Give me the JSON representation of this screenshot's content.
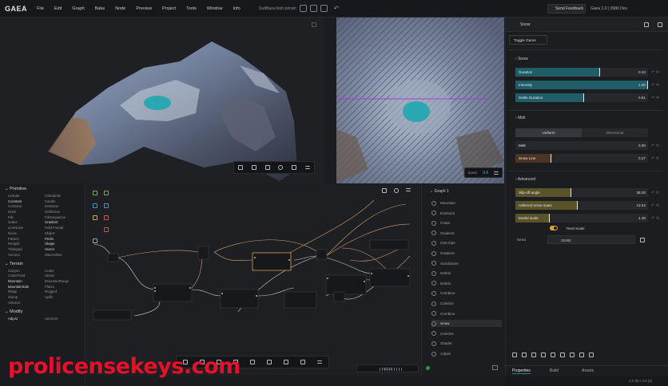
{
  "app": {
    "logo": "GAEA",
    "menu": [
      "File",
      "Edit",
      "Graph",
      "Bake",
      "Node",
      "Preview",
      "Project",
      "Tools",
      "Window",
      "Info"
    ],
    "doc_name": "SwitBassJooh.terrain",
    "send_feedback": "Send Feedback",
    "version": "Gaea 2.0 | 0986 Dev"
  },
  "viewport2": {
    "zoom_label": "Zoom",
    "zoom_value": "0.6"
  },
  "library": {
    "primitive_title": "Primitive",
    "primitive": [
      [
        "Cellular",
        "Cellular3D"
      ],
      [
        "Constant",
        "Candle"
      ],
      [
        "CutNoise",
        "DotNoise"
      ],
      [
        "Draw",
        "DriftNoise"
      ],
      [
        "File",
        "FileSequence"
      ],
      [
        "Gabor",
        "Gradient"
      ],
      [
        "LineNoise",
        "Hold Fractal"
      ],
      [
        "Noise",
        "Object"
      ],
      [
        "Pattern",
        "Perlin"
      ],
      [
        "Respirit",
        "Shape"
      ],
      [
        "Thinkpad",
        "Vector"
      ],
      [
        "Voronoi",
        "WaveShine"
      ]
    ],
    "terrain_title": "Terrain",
    "terrain": [
      [
        "Canyon",
        "Crater"
      ],
      [
        "CraterField",
        "Island"
      ],
      [
        "Mountain",
        "MountainRange"
      ],
      [
        "MountainSide",
        "Plates"
      ],
      [
        "Ridge",
        "Rugged"
      ],
      [
        "Slump",
        "Uplift"
      ],
      [
        "Volcano",
        ""
      ]
    ],
    "modify_title": "Modify",
    "modify": [
      [
        "Adjust",
        "Aperture"
      ]
    ]
  },
  "nodelist": {
    "graph_title": "Graph 1",
    "items": [
      "Mountain",
      "Erosion2",
      "Crater",
      "Gradient",
      "Outcrops",
      "Gradient",
      "SandStone",
      "Debris",
      "Debris",
      "Combine",
      "Colorize",
      "Combine",
      "Snow",
      "Colorize",
      "Shader",
      "Adjust"
    ],
    "selected_index": 12
  },
  "props": {
    "tab_title": "Snow",
    "toggle_label": "Toggle Game",
    "snow_section": "Snow",
    "snow": [
      {
        "label": "Duration",
        "value": "0.43",
        "fraction": 0.64
      },
      {
        "label": "Intensity",
        "value": "1.00",
        "fraction": 1.0
      },
      {
        "label": "Settle Duration",
        "value": "0.51",
        "fraction": 0.52
      }
    ],
    "melt_section": "Melt",
    "melt_tabs": [
      "Uniform",
      "Directional"
    ],
    "melt": [
      {
        "label": "Melt",
        "value": "0.00",
        "fraction": 0.0
      },
      {
        "label": "Snow Line",
        "value": "0.27",
        "fraction": 0.27
      }
    ],
    "adv_section": "Advanced",
    "advanced": [
      {
        "label": "Slip-off angle",
        "value": "38.00",
        "fraction": 0.42
      },
      {
        "label": "Adhered snow mass",
        "value": "13.52",
        "fraction": 0.47
      },
      {
        "label": "Model scale",
        "value": "4.28",
        "fraction": 0.26
      }
    ],
    "real_scale": "Real Scale",
    "seed_label": "Seed",
    "seed_value": "22265",
    "bottom_tabs": [
      "Properties",
      "Build",
      "Assets"
    ],
    "status": "1.0 (8) / 4.0 (2)"
  },
  "graph": {
    "time": "00:23"
  },
  "watermark": "prolicensekeys.com",
  "colors": {
    "accent": "#2f7f87",
    "fill_teal": "#1f5e66",
    "fill_olive": "#5a5228",
    "fill_brown": "#4c3424",
    "lake": "#2aa7b0"
  }
}
